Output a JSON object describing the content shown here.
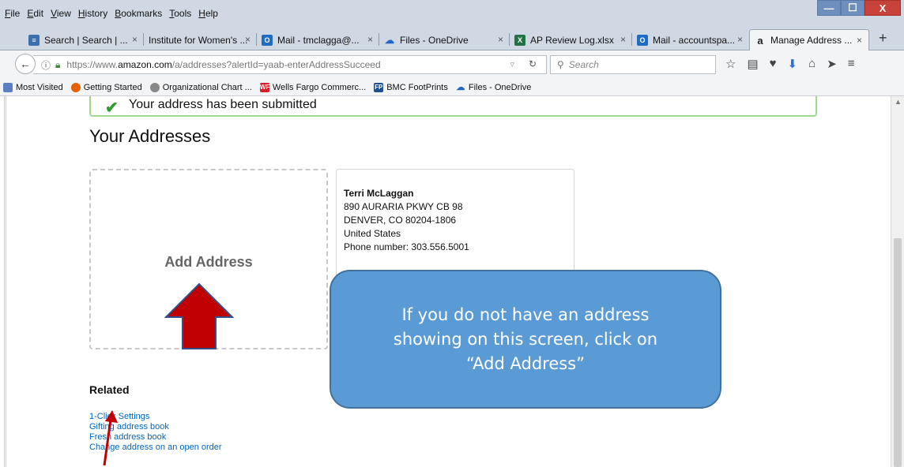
{
  "menu": [
    "File",
    "Edit",
    "View",
    "History",
    "Bookmarks",
    "Tools",
    "Help"
  ],
  "window_controls": {
    "minimize": "—",
    "maximize": "☐",
    "close": "X"
  },
  "tabs": [
    {
      "label": "Search | Search | ...",
      "icon": "search-site-icon",
      "icon_color": "#3a6fb0"
    },
    {
      "label": "Institute for Women's ...",
      "icon": "",
      "icon_color": ""
    },
    {
      "label": "Mail - tmclagga@...",
      "icon": "outlook-icon",
      "icon_color": "#1f6cc2"
    },
    {
      "label": "Files - OneDrive",
      "icon": "onedrive-icon",
      "icon_color": "#1e66c7"
    },
    {
      "label": "AP Review Log.xlsx",
      "icon": "excel-icon",
      "icon_color": "#217346"
    },
    {
      "label": "Mail - accountspa...",
      "icon": "outlook-icon",
      "icon_color": "#1f6cc2"
    },
    {
      "label": "Manage Address ...",
      "icon": "amazon-icon",
      "icon_color": "#222222"
    }
  ],
  "tab_close": "×",
  "new_tab": "+",
  "url": {
    "prefix": "https://www.",
    "domain": "amazon.com",
    "suffix": "/a/addresses?alertId=yaab-enterAddressSucceed"
  },
  "search": {
    "placeholder": "Search"
  },
  "bookmarks": [
    {
      "label": "Most Visited",
      "icon_color": "#5b7fc4"
    },
    {
      "label": "Getting Started",
      "icon_color": "#e66000"
    },
    {
      "label": "Organizational Chart ...",
      "icon_color": "#888888"
    },
    {
      "label": "Wells Fargo Commerc...",
      "icon_color": "#d71e28"
    },
    {
      "label": "BMC FootPrints",
      "icon_color": "#1d4f91"
    },
    {
      "label": "Files - OneDrive",
      "icon_color": "#1e66c7"
    }
  ],
  "alert": {
    "message": "Your address has been submitted"
  },
  "page": {
    "title": "Your Addresses"
  },
  "add_tile": {
    "label": "Add Address"
  },
  "address": {
    "name": "Terri McLaggan",
    "line1": "890 AURARIA PKWY CB 98",
    "line2": "DENVER, CO 80204-1806",
    "country": "United States",
    "phone": "Phone number: 303.556.5001"
  },
  "related": {
    "heading": "Related",
    "links": [
      "1-Click Settings",
      "Gifting address book",
      "Fresh address book",
      "Change address on an open order"
    ]
  },
  "callout": {
    "text": "If you do not have an address showing on this screen, click on “Add Address”"
  },
  "colors": {
    "callout": "#5b9bd5",
    "arrow": "#c00000",
    "link": "#0066c0",
    "alert_border": "#9ed98f"
  }
}
